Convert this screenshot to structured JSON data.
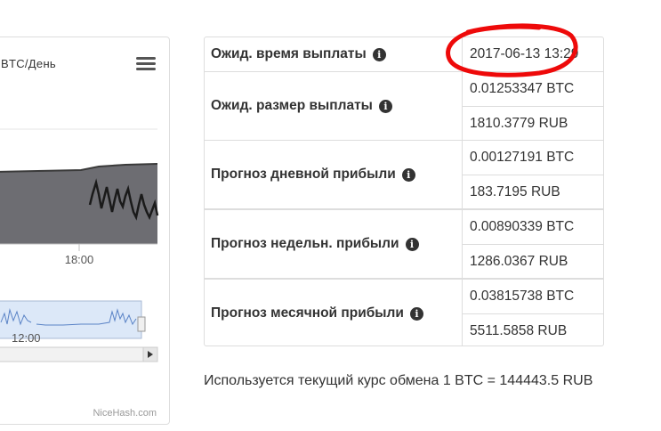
{
  "chart": {
    "title": "BTC/День",
    "x_tick": "18:00",
    "navigator_tick": "12:00",
    "credit": "NiceHash.com",
    "colors": {
      "area": "#6d6d72",
      "navigator": "#dce8f8",
      "series": "#222222"
    }
  },
  "table": {
    "rows": [
      {
        "label": "Ожид. время выплаты",
        "values": [
          "2017-06-13 13:29"
        ]
      },
      {
        "label": "Ожид. размер выплаты",
        "values": [
          "0.01253347 BTC",
          "1810.3779 RUB"
        ]
      },
      {
        "label": "Прогноз дневной прибыли",
        "values": [
          "0.00127191 BTC",
          "183.7195 RUB"
        ]
      },
      {
        "label": "Прогноз недельн. прибыли",
        "values": [
          "0.00890339 BTC",
          "1286.0367 RUB"
        ]
      },
      {
        "label": "Прогноз месячной прибыли",
        "values": [
          "0.03815738 BTC",
          "5511.5858 RUB"
        ]
      }
    ],
    "info_icon": "info-icon"
  },
  "note": "Используется текущий курс обмена 1 BTC = 144443.5 RUB"
}
